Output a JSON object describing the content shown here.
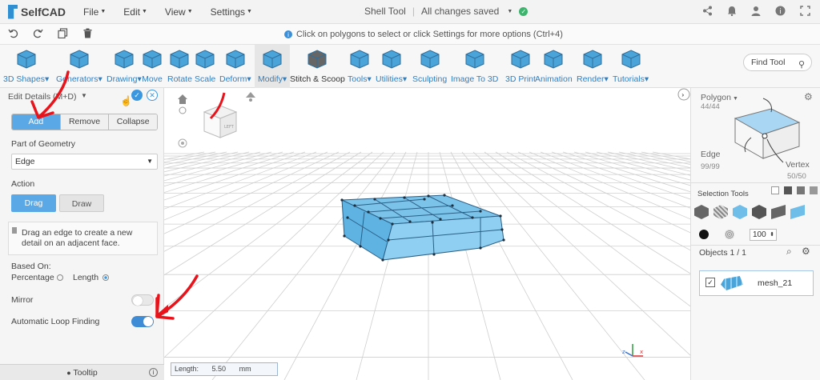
{
  "app": {
    "logo_text": "SelfCAD",
    "menu": [
      "File",
      "Edit",
      "View",
      "Settings"
    ],
    "doc_title": "Shell Tool",
    "save_status": "All changes saved"
  },
  "hint": "Click on polygons to select or click Settings for more options (Ctrl+4)",
  "toolbar": {
    "tools": [
      {
        "label": "3D Shapes",
        "caret": true
      },
      {
        "label": "Generators",
        "caret": true
      },
      {
        "label": "Drawing",
        "caret": true
      },
      {
        "label": "Move",
        "caret": false
      },
      {
        "label": "Rotate",
        "caret": false
      },
      {
        "label": "Scale",
        "caret": false
      },
      {
        "label": "Deform",
        "caret": true
      },
      {
        "label": "Modify",
        "caret": true
      },
      {
        "label": "Stitch & Scoop",
        "caret": false
      },
      {
        "label": "Tools",
        "caret": true
      },
      {
        "label": "Utilities",
        "caret": true
      },
      {
        "label": "Sculpting",
        "caret": false
      },
      {
        "label": "Image To 3D",
        "caret": false
      },
      {
        "label": "3D Print",
        "caret": false
      },
      {
        "label": "Animation",
        "caret": false
      },
      {
        "label": "Render",
        "caret": true
      },
      {
        "label": "Tutorials",
        "caret": true
      }
    ],
    "find_tool": "Find Tool"
  },
  "left_panel": {
    "title": "Edit Details (M+D)",
    "tabs": [
      "Add",
      "Remove",
      "Collapse"
    ],
    "active_tab": "Add",
    "part_of_geometry_label": "Part of Geometry",
    "part_of_geometry_value": "Edge",
    "action_label": "Action",
    "action_buttons": [
      "Drag",
      "Draw"
    ],
    "active_action": "Drag",
    "info_text": "Drag an edge to create a new detail on an adjacent face.",
    "based_on_label": "Based On:",
    "based_on_options": [
      "Percentage",
      "Length"
    ],
    "based_on_selected": "Length",
    "mirror_label": "Mirror",
    "mirror_on": false,
    "auto_loop_label": "Automatic Loop Finding",
    "auto_loop_on": true,
    "tooltip_label": "Tooltip"
  },
  "viewport": {
    "length_label": "Length:",
    "length_value": "5.50",
    "length_unit": "mm",
    "cube_face_label": "LEFT"
  },
  "right_panel": {
    "polygon_label": "Polygon",
    "polygon_count": "44/44",
    "edge_label": "Edge",
    "edge_count": "99/99",
    "vertex_label": "Vertex",
    "vertex_count": "50/50",
    "selection_tools_label": "Selection Tools",
    "opacity_value": "100",
    "objects_label": "Objects 1 / 1",
    "object_name": "mesh_21"
  },
  "colors": {
    "accent": "#3b98e0",
    "mesh": "#7cc3ea",
    "annotation": "#e8131b"
  }
}
